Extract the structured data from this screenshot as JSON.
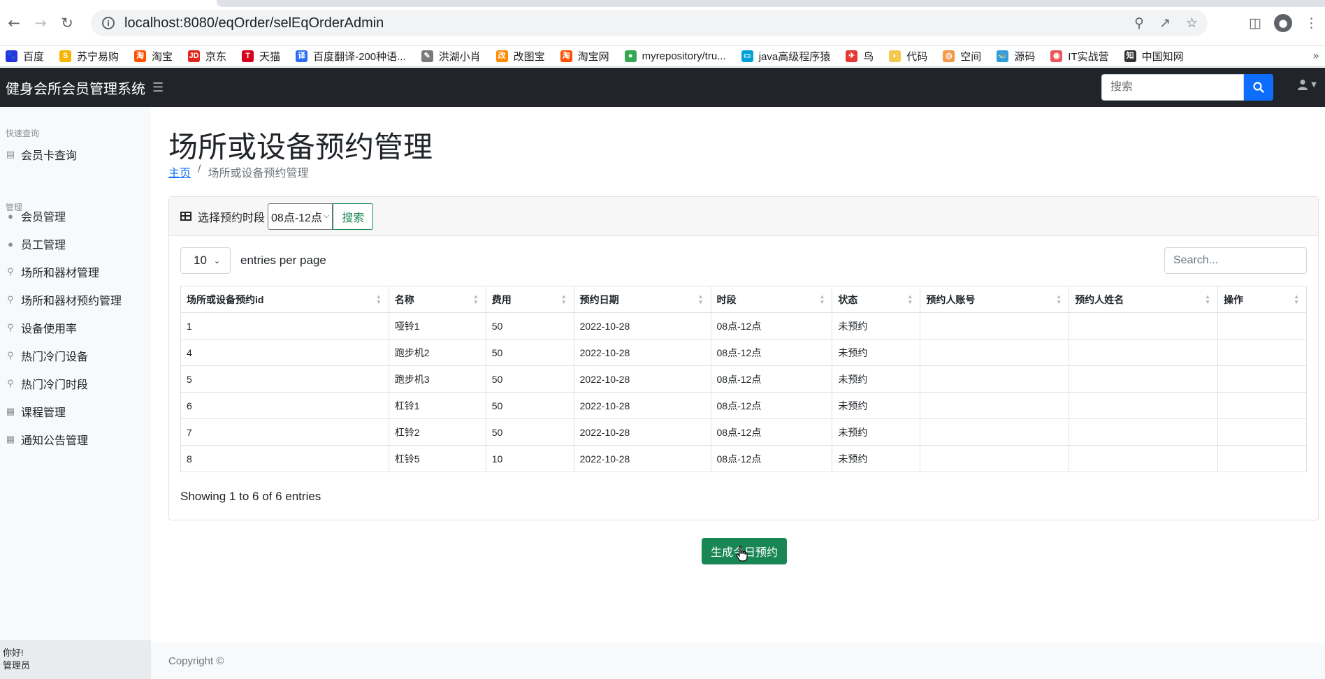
{
  "browser": {
    "url": "localhost:8080/eqOrder/selEqOrderAdmin",
    "bookmarks": [
      {
        "label": "百度",
        "color": "#2932e1",
        "glyph": "🐾"
      },
      {
        "label": "苏宁易购",
        "color": "#f7b500",
        "glyph": "S"
      },
      {
        "label": "淘宝",
        "color": "#ff5000",
        "glyph": "淘"
      },
      {
        "label": "京东",
        "color": "#e1251b",
        "glyph": "JD"
      },
      {
        "label": "天猫",
        "color": "#d9001b",
        "glyph": "T"
      },
      {
        "label": "百度翻译-200种语...",
        "color": "#2b6cf6",
        "glyph": "译"
      },
      {
        "label": "洪湖小肖",
        "color": "#7a7a7a",
        "glyph": "✎"
      },
      {
        "label": "改图宝",
        "color": "#ff8a00",
        "glyph": "改"
      },
      {
        "label": "淘宝网",
        "color": "#ff5000",
        "glyph": "淘"
      },
      {
        "label": "myrepository/tru...",
        "color": "#34a853",
        "glyph": "●"
      },
      {
        "label": "java高级程序猿",
        "color": "#00a1d6",
        "glyph": "▭"
      },
      {
        "label": "鸟",
        "color": "#e53935",
        "glyph": "✈"
      },
      {
        "label": "代码",
        "color": "#f2c94c",
        "glyph": "◐"
      },
      {
        "label": "空间",
        "color": "#f2994a",
        "glyph": "◎"
      },
      {
        "label": "源码",
        "color": "#2d9cdb",
        "glyph": "🐳"
      },
      {
        "label": "IT实战营",
        "color": "#eb5757",
        "glyph": "◉"
      },
      {
        "label": "中国知网",
        "color": "#333333",
        "glyph": "知"
      }
    ]
  },
  "navbar": {
    "brand": "健身会所会员管理系统",
    "search_placeholder": "搜索"
  },
  "sidebar": {
    "heading_quick": "快速查询",
    "heading_manage": "管理",
    "items": [
      {
        "label": "会员卡查询",
        "icon": "id-card-icon"
      },
      {
        "label": "会员管理",
        "icon": "user-icon"
      },
      {
        "label": "员工管理",
        "icon": "user-icon"
      },
      {
        "label": "场所和器材管理",
        "icon": "dumbbell-icon"
      },
      {
        "label": "场所和器材预约管理",
        "icon": "dumbbell-icon"
      },
      {
        "label": "设备使用率",
        "icon": "dumbbell-icon"
      },
      {
        "label": "热门冷门设备",
        "icon": "dumbbell-icon"
      },
      {
        "label": "热门冷门时段",
        "icon": "dumbbell-icon"
      },
      {
        "label": "课程管理",
        "icon": "calendar-icon"
      },
      {
        "label": "通知公告管理",
        "icon": "calendar-icon"
      }
    ],
    "footer_line1": "你好!",
    "footer_line2": "管理员"
  },
  "main": {
    "title": "场所或设备预约管理",
    "breadcrumb_home": "主页",
    "breadcrumb_current": "场所或设备预约管理",
    "filter_label": "选择预约时段",
    "filter_selected": "08点-12点",
    "filter_button": "搜索",
    "per_page_value": "10",
    "per_page_label": "entries per page",
    "table_search_placeholder": "Search...",
    "columns": [
      "场所或设备预约id",
      "名称",
      "费用",
      "预约日期",
      "时段",
      "状态",
      "预约人账号",
      "预约人姓名",
      "操作"
    ],
    "rows": [
      [
        "1",
        "哑铃1",
        "50",
        "2022-10-28",
        "08点-12点",
        "未预约",
        "",
        "",
        ""
      ],
      [
        "4",
        "跑步机2",
        "50",
        "2022-10-28",
        "08点-12点",
        "未预约",
        "",
        "",
        ""
      ],
      [
        "5",
        "跑步机3",
        "50",
        "2022-10-28",
        "08点-12点",
        "未预约",
        "",
        "",
        ""
      ],
      [
        "6",
        "杠铃1",
        "50",
        "2022-10-28",
        "08点-12点",
        "未预约",
        "",
        "",
        ""
      ],
      [
        "7",
        "杠铃2",
        "50",
        "2022-10-28",
        "08点-12点",
        "未预约",
        "",
        "",
        ""
      ],
      [
        "8",
        "杠铃5",
        "10",
        "2022-10-28",
        "08点-12点",
        "未预约",
        "",
        "",
        ""
      ]
    ],
    "info": "Showing 1 to 6 of 6 entries",
    "generate_button": "生成今日预约"
  },
  "footer": {
    "copyright": "Copyright ©"
  }
}
